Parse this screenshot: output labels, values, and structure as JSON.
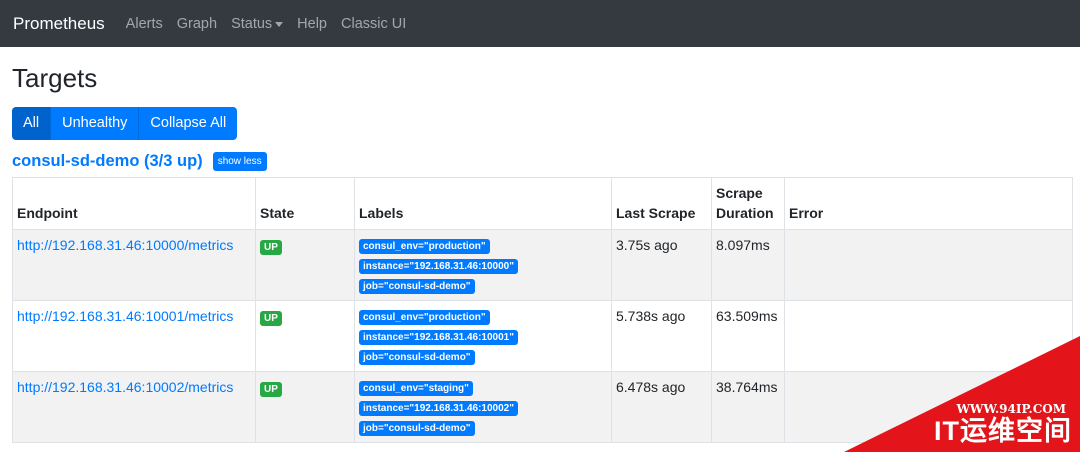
{
  "nav": {
    "brand": "Prometheus",
    "items": [
      {
        "label": "Alerts"
      },
      {
        "label": "Graph"
      },
      {
        "label": "Status",
        "dropdown": true
      },
      {
        "label": "Help"
      },
      {
        "label": "Classic UI"
      }
    ]
  },
  "page": {
    "title": "Targets",
    "filters": [
      "All",
      "Unhealthy",
      "Collapse All"
    ],
    "active_filter": "All"
  },
  "job": {
    "title": "consul-sd-demo (3/3 up)",
    "toggle_label": "show less",
    "columns": [
      "Endpoint",
      "State",
      "Labels",
      "Last Scrape",
      "Scrape Duration",
      "Error"
    ],
    "rows": [
      {
        "endpoint": "http://192.168.31.46:10000/metrics",
        "state": "UP",
        "labels": [
          "consul_env=\"production\"",
          "instance=\"192.168.31.46:10000\"",
          "job=\"consul-sd-demo\""
        ],
        "last_scrape": "3.75s ago",
        "duration": "8.097ms",
        "error": ""
      },
      {
        "endpoint": "http://192.168.31.46:10001/metrics",
        "state": "UP",
        "labels": [
          "consul_env=\"production\"",
          "instance=\"192.168.31.46:10001\"",
          "job=\"consul-sd-demo\""
        ],
        "last_scrape": "5.738s ago",
        "duration": "63.509ms",
        "error": ""
      },
      {
        "endpoint": "http://192.168.31.46:10002/metrics",
        "state": "UP",
        "labels": [
          "consul_env=\"staging\"",
          "instance=\"192.168.31.46:10002\"",
          "job=\"consul-sd-demo\""
        ],
        "last_scrape": "6.478s ago",
        "duration": "38.764ms",
        "error": ""
      }
    ]
  },
  "watermark": {
    "url": "WWW.94IP.COM",
    "name": "IT运维空间"
  },
  "colors": {
    "navbar": "#343a40",
    "primary": "#007bff",
    "success": "#28a745",
    "watermark": "#e3151a"
  }
}
